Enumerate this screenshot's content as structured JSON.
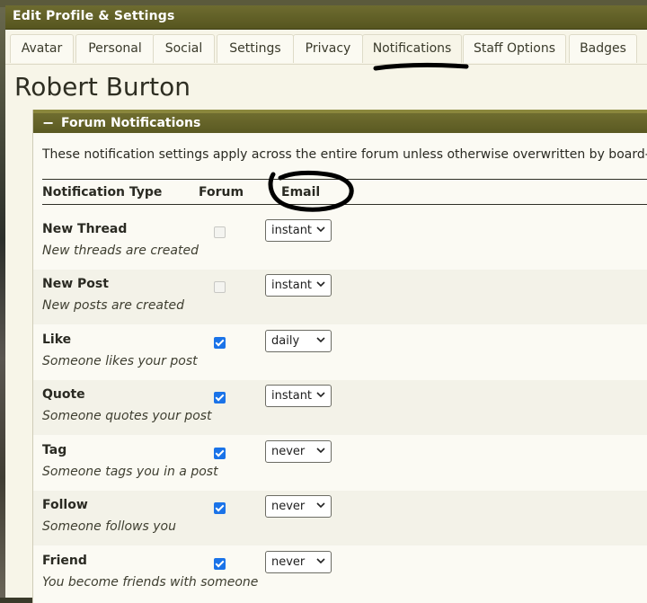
{
  "window": {
    "title": "Edit Profile & Settings"
  },
  "tabs": [
    {
      "label": "Avatar"
    },
    {
      "label": "Personal"
    },
    {
      "label": "Social"
    },
    {
      "label": "Settings"
    },
    {
      "label": "Privacy"
    },
    {
      "label": "Notifications",
      "active": true
    },
    {
      "label": "Staff Options"
    },
    {
      "label": "Badges"
    }
  ],
  "profile": {
    "name": "Robert Burton"
  },
  "section": {
    "collapse_symbol": "−",
    "title": "Forum Notifications",
    "intro": "These notification settings apply across the entire forum unless otherwise overwritten by board-spec"
  },
  "columns": {
    "type": "Notification Type",
    "forum": "Forum",
    "email": "Email"
  },
  "rows": [
    {
      "title": "New Thread",
      "desc": "New threads are created",
      "forum_checked": false,
      "email": "instant"
    },
    {
      "title": "New Post",
      "desc": "New posts are created",
      "forum_checked": false,
      "email": "instant"
    },
    {
      "title": "Like",
      "desc": "Someone likes your post",
      "forum_checked": true,
      "email": "daily"
    },
    {
      "title": "Quote",
      "desc": "Someone quotes your post",
      "forum_checked": true,
      "email": "instant"
    },
    {
      "title": "Tag",
      "desc": "Someone tags you in a post",
      "forum_checked": true,
      "email": "never"
    },
    {
      "title": "Follow",
      "desc": "Someone follows you",
      "forum_checked": true,
      "email": "never"
    },
    {
      "title": "Friend",
      "desc": "You become friends with someone",
      "forum_checked": true,
      "email": "never"
    }
  ],
  "annotations": {
    "stroke_color": "#000000"
  },
  "colors": {
    "accent": "#5d5c24",
    "checkbox": "#1a73e8",
    "background": "#f7f5e8"
  }
}
